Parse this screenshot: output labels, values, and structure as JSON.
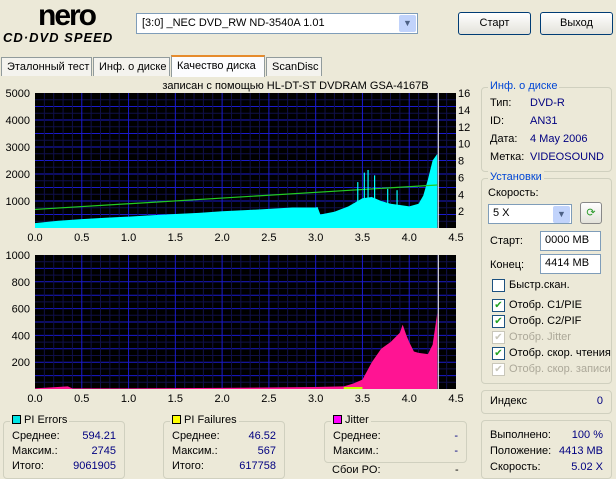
{
  "logo": {
    "line1": "nero",
    "line2": "CD·DVD SPEED"
  },
  "drive": {
    "selected": "[3:0]  _NEC DVD_RW ND-3540A 1.01"
  },
  "buttons": {
    "start": "Старт",
    "exit": "Выход"
  },
  "tabs": [
    "Эталонный тест",
    "Инф. о диске",
    "Качество диска",
    "ScanDisc"
  ],
  "active_tab": "Качество диска",
  "disc_info": {
    "title": "Инф. о диске",
    "type_label": "Тип:",
    "type": "DVD-R",
    "id_label": "ID:",
    "id": "AN31",
    "date_label": "Дата:",
    "date": "4 May 2006",
    "label_label": "Метка:",
    "label": "VIDEOSOUND"
  },
  "settings": {
    "title": "Установки",
    "speed_label": "Скорость:",
    "speed": "5 X",
    "start_label": "Старт:",
    "start": "0000 MB",
    "end_label": "Конец:",
    "end": "4414 MB",
    "checks": [
      {
        "label": "Быстр.скан.",
        "checked": false,
        "disabled": false
      },
      {
        "label": "Отобр. C1/PIE",
        "checked": true,
        "disabled": false
      },
      {
        "label": "Отобр. C2/PIF",
        "checked": true,
        "disabled": false
      },
      {
        "label": "Отобр. Jitter",
        "checked": true,
        "disabled": true
      },
      {
        "label": "Отобр. скор. чтения",
        "checked": true,
        "disabled": false
      },
      {
        "label": "Отобр. скор. записи",
        "checked": true,
        "disabled": true
      }
    ]
  },
  "index": {
    "label": "Индекс",
    "value": "0"
  },
  "progress": {
    "done_label": "Выполнено:",
    "done": "100 %",
    "pos_label": "Положение:",
    "pos": "4413 MB",
    "speed_label": "Скорость:",
    "speed": "5.02 X"
  },
  "pi_errors": {
    "title": "PI Errors",
    "color": "#00e5e5",
    "avg_label": "Среднее:",
    "avg": "594.21",
    "max_label": "Максим.:",
    "max": "2745",
    "total_label": "Итого:",
    "total": "9061905"
  },
  "pi_failures": {
    "title": "PI Failures",
    "color": "#ffff00",
    "avg_label": "Среднее:",
    "avg": "46.52",
    "max_label": "Максим.:",
    "max": "567",
    "total_label": "Итого:",
    "total": "617758"
  },
  "jitter": {
    "title": "Jitter",
    "color": "#ff00ff",
    "avg_label": "Среднее:",
    "avg": "-",
    "max_label": "Максим.:",
    "max": "-",
    "po_label": "Сбои PO:",
    "po": "-"
  },
  "chart_data": [
    {
      "type": "area",
      "title": "записан с помощью HL-DT-ST DVDRAM GSA-4167B",
      "xlim": [
        0,
        4.5
      ],
      "ylim": [
        0,
        5000
      ],
      "y2lim": [
        0,
        16
      ],
      "xticks": [
        "0.0",
        "0.5",
        "1.0",
        "1.5",
        "2.0",
        "2.5",
        "3.0",
        "3.5",
        "4.0",
        "4.5"
      ],
      "yticks": [
        "5000",
        "4000",
        "3000",
        "2000",
        "1000"
      ],
      "y2ticks": [
        "16",
        "14",
        "12",
        "10",
        "8",
        "6",
        "4",
        "2"
      ],
      "series": [
        {
          "name": "PI Errors",
          "color": "#00ffff",
          "x": [
            0,
            0.25,
            0.5,
            0.75,
            1.0,
            1.25,
            1.5,
            1.75,
            2.0,
            2.25,
            2.5,
            2.75,
            3.0,
            3.02,
            3.05,
            3.2,
            3.35,
            3.5,
            3.6,
            3.7,
            3.8,
            3.9,
            4.0,
            4.1,
            4.15,
            4.2,
            4.25,
            4.3
          ],
          "y": [
            180,
            270,
            330,
            380,
            420,
            470,
            520,
            560,
            620,
            660,
            710,
            760,
            760,
            780,
            500,
            600,
            800,
            1100,
            1150,
            1000,
            900,
            850,
            800,
            900,
            1200,
            1800,
            2500,
            2745
          ]
        },
        {
          "name": "Read speed",
          "color": "#22cc22",
          "axis": "right",
          "x": [
            0,
            4.3
          ],
          "y": [
            2.2,
            5.1
          ]
        }
      ],
      "spikes": {
        "x": [
          3.45,
          3.52,
          3.56,
          3.63,
          3.77,
          3.87
        ],
        "y": [
          1700,
          2050,
          2150,
          1950,
          1450,
          1400
        ]
      }
    },
    {
      "type": "area",
      "xlim": [
        0,
        4.5
      ],
      "ylim": [
        0,
        1000
      ],
      "xticks": [
        "0.0",
        "0.5",
        "1.0",
        "1.5",
        "2.0",
        "2.5",
        "3.0",
        "3.5",
        "4.0",
        "4.5"
      ],
      "yticks": [
        "1000",
        "800",
        "600",
        "400",
        "200"
      ],
      "series": [
        {
          "name": "PI Failures",
          "color": "#ff1493",
          "x": [
            0,
            0.35,
            0.4,
            1.0,
            2.0,
            3.0,
            3.3,
            3.4,
            3.5,
            3.6,
            3.7,
            3.8,
            3.9,
            3.93,
            3.97,
            4.0,
            4.05,
            4.1,
            4.2,
            4.25,
            4.3
          ],
          "y": [
            5,
            20,
            5,
            5,
            8,
            15,
            20,
            40,
            70,
            200,
            300,
            350,
            420,
            480,
            400,
            350,
            280,
            270,
            260,
            330,
            567
          ]
        }
      ]
    }
  ]
}
